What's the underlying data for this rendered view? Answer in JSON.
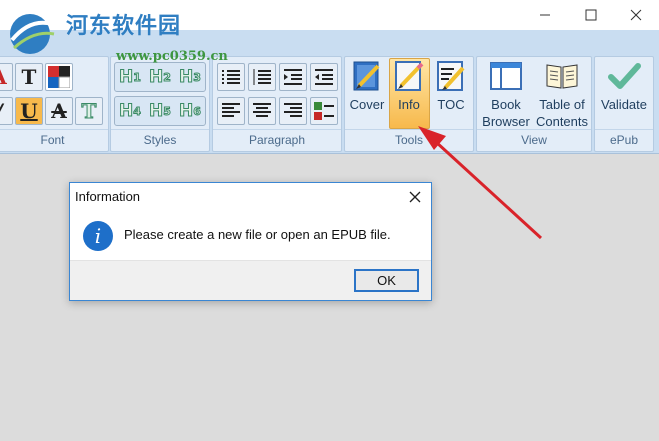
{
  "watermark": {
    "title": "河东软件园",
    "url": "www.pc0359.cn"
  },
  "window": {
    "min_icon": "minimize-icon",
    "max_icon": "maximize-icon",
    "close_icon": "close-icon"
  },
  "ribbon": {
    "groups": {
      "font": "Font",
      "styles": "Styles",
      "paragraph": "Paragraph",
      "tools": "Tools",
      "view": "View",
      "epub": "ePub"
    },
    "font_buttons": {
      "a": "A",
      "t": "T",
      "u": "U",
      "strike": "A",
      "t_outline": "T",
      "slash": "/"
    },
    "headings": [
      {
        "h": "H",
        "n": "1"
      },
      {
        "h": "H",
        "n": "2"
      },
      {
        "h": "H",
        "n": "3"
      },
      {
        "h": "H",
        "n": "4"
      },
      {
        "h": "H",
        "n": "5"
      },
      {
        "h": "H",
        "n": "6"
      }
    ],
    "tools": {
      "cover": "Cover",
      "info": "Info",
      "toc": "TOC"
    },
    "view": {
      "book_browser_1": "Book",
      "book_browser_2": "Browser",
      "toc_1": "Table of",
      "toc_2": "Contents"
    },
    "epub": {
      "validate": "Validate"
    }
  },
  "dialog": {
    "title": "Information",
    "message": "Please create a new file or open an EPUB file.",
    "ok": "OK"
  },
  "colors": {
    "accent": "#2b74c7",
    "ribbon": "#c9ddf1",
    "highlight": "#f7b94c",
    "arrow": "#d9232a"
  }
}
